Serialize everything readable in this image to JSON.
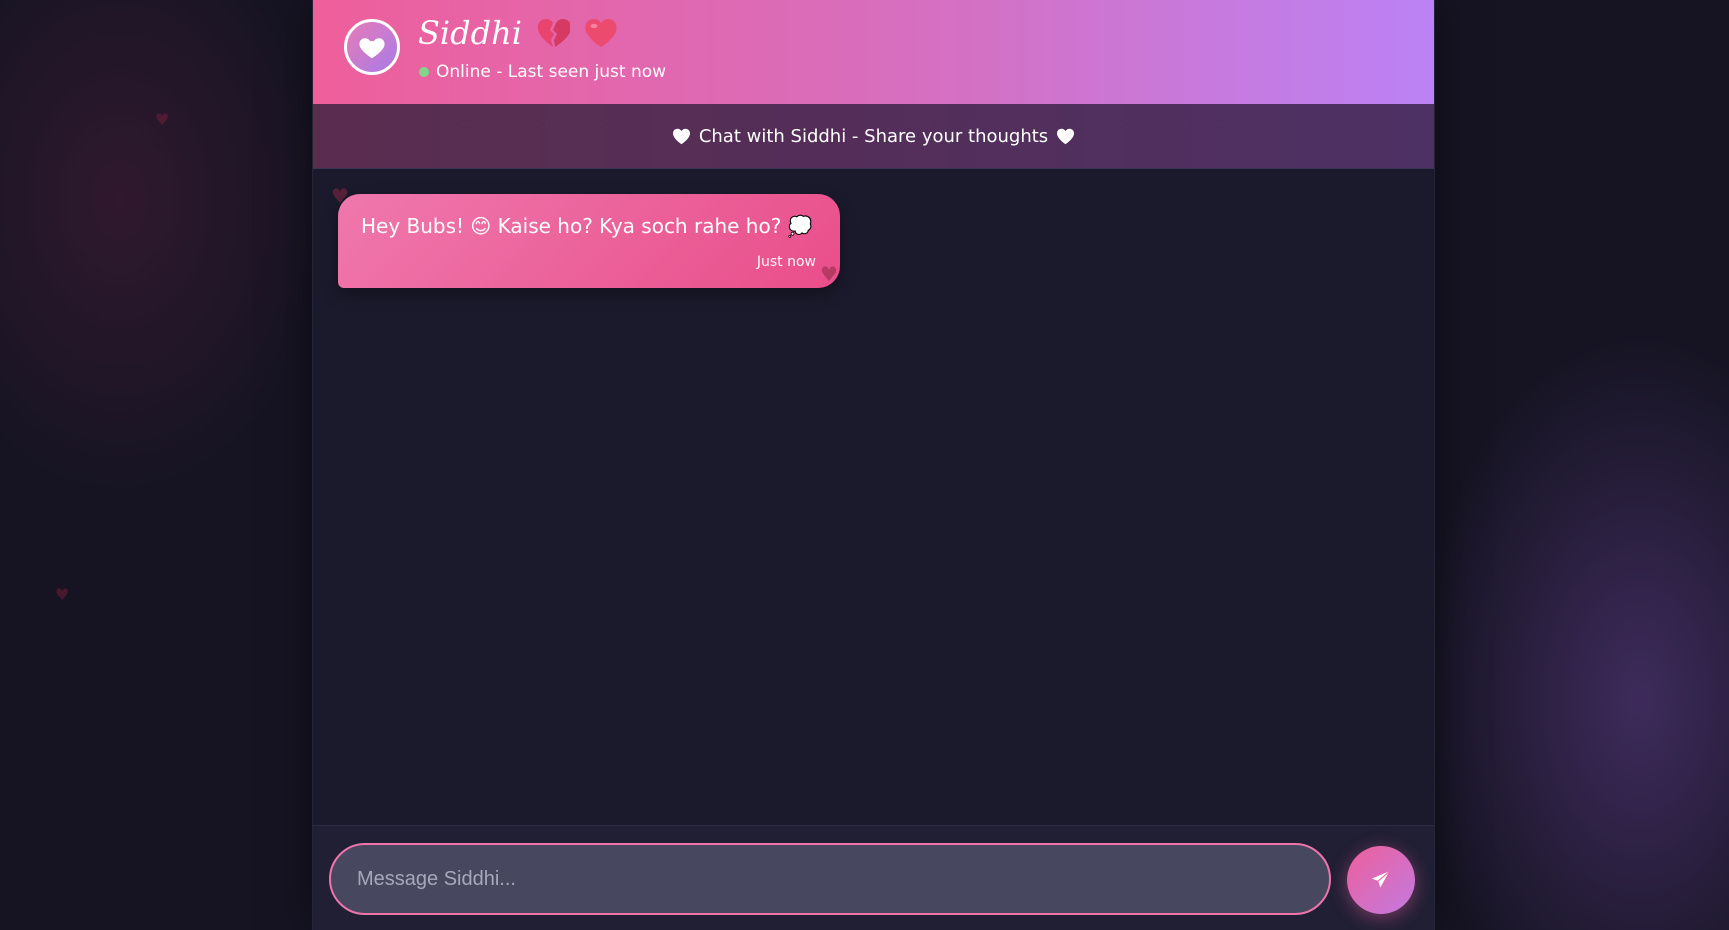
{
  "header": {
    "contact_name": "Siddhi",
    "status_text": "Online - Last seen just now",
    "avatar_icon": "heart-icon",
    "name_emojis": [
      "broken-heart-emoji",
      "red-heart-emoji"
    ]
  },
  "banner": {
    "text": "Chat with Siddhi - Share your thoughts"
  },
  "messages": [
    {
      "text": "Hey Bubs! 😊 Kaise ho? Kya soch rahe ho? 💭",
      "time": "Just now",
      "sender": "Siddhi"
    }
  ],
  "composer": {
    "placeholder": "Message Siddhi...",
    "value": "",
    "send_icon": "send-icon"
  },
  "colors": {
    "accent_pink": "#ee5f9b",
    "accent_purple": "#bb82f5",
    "online": "#7fd68a",
    "background": "#161423"
  }
}
